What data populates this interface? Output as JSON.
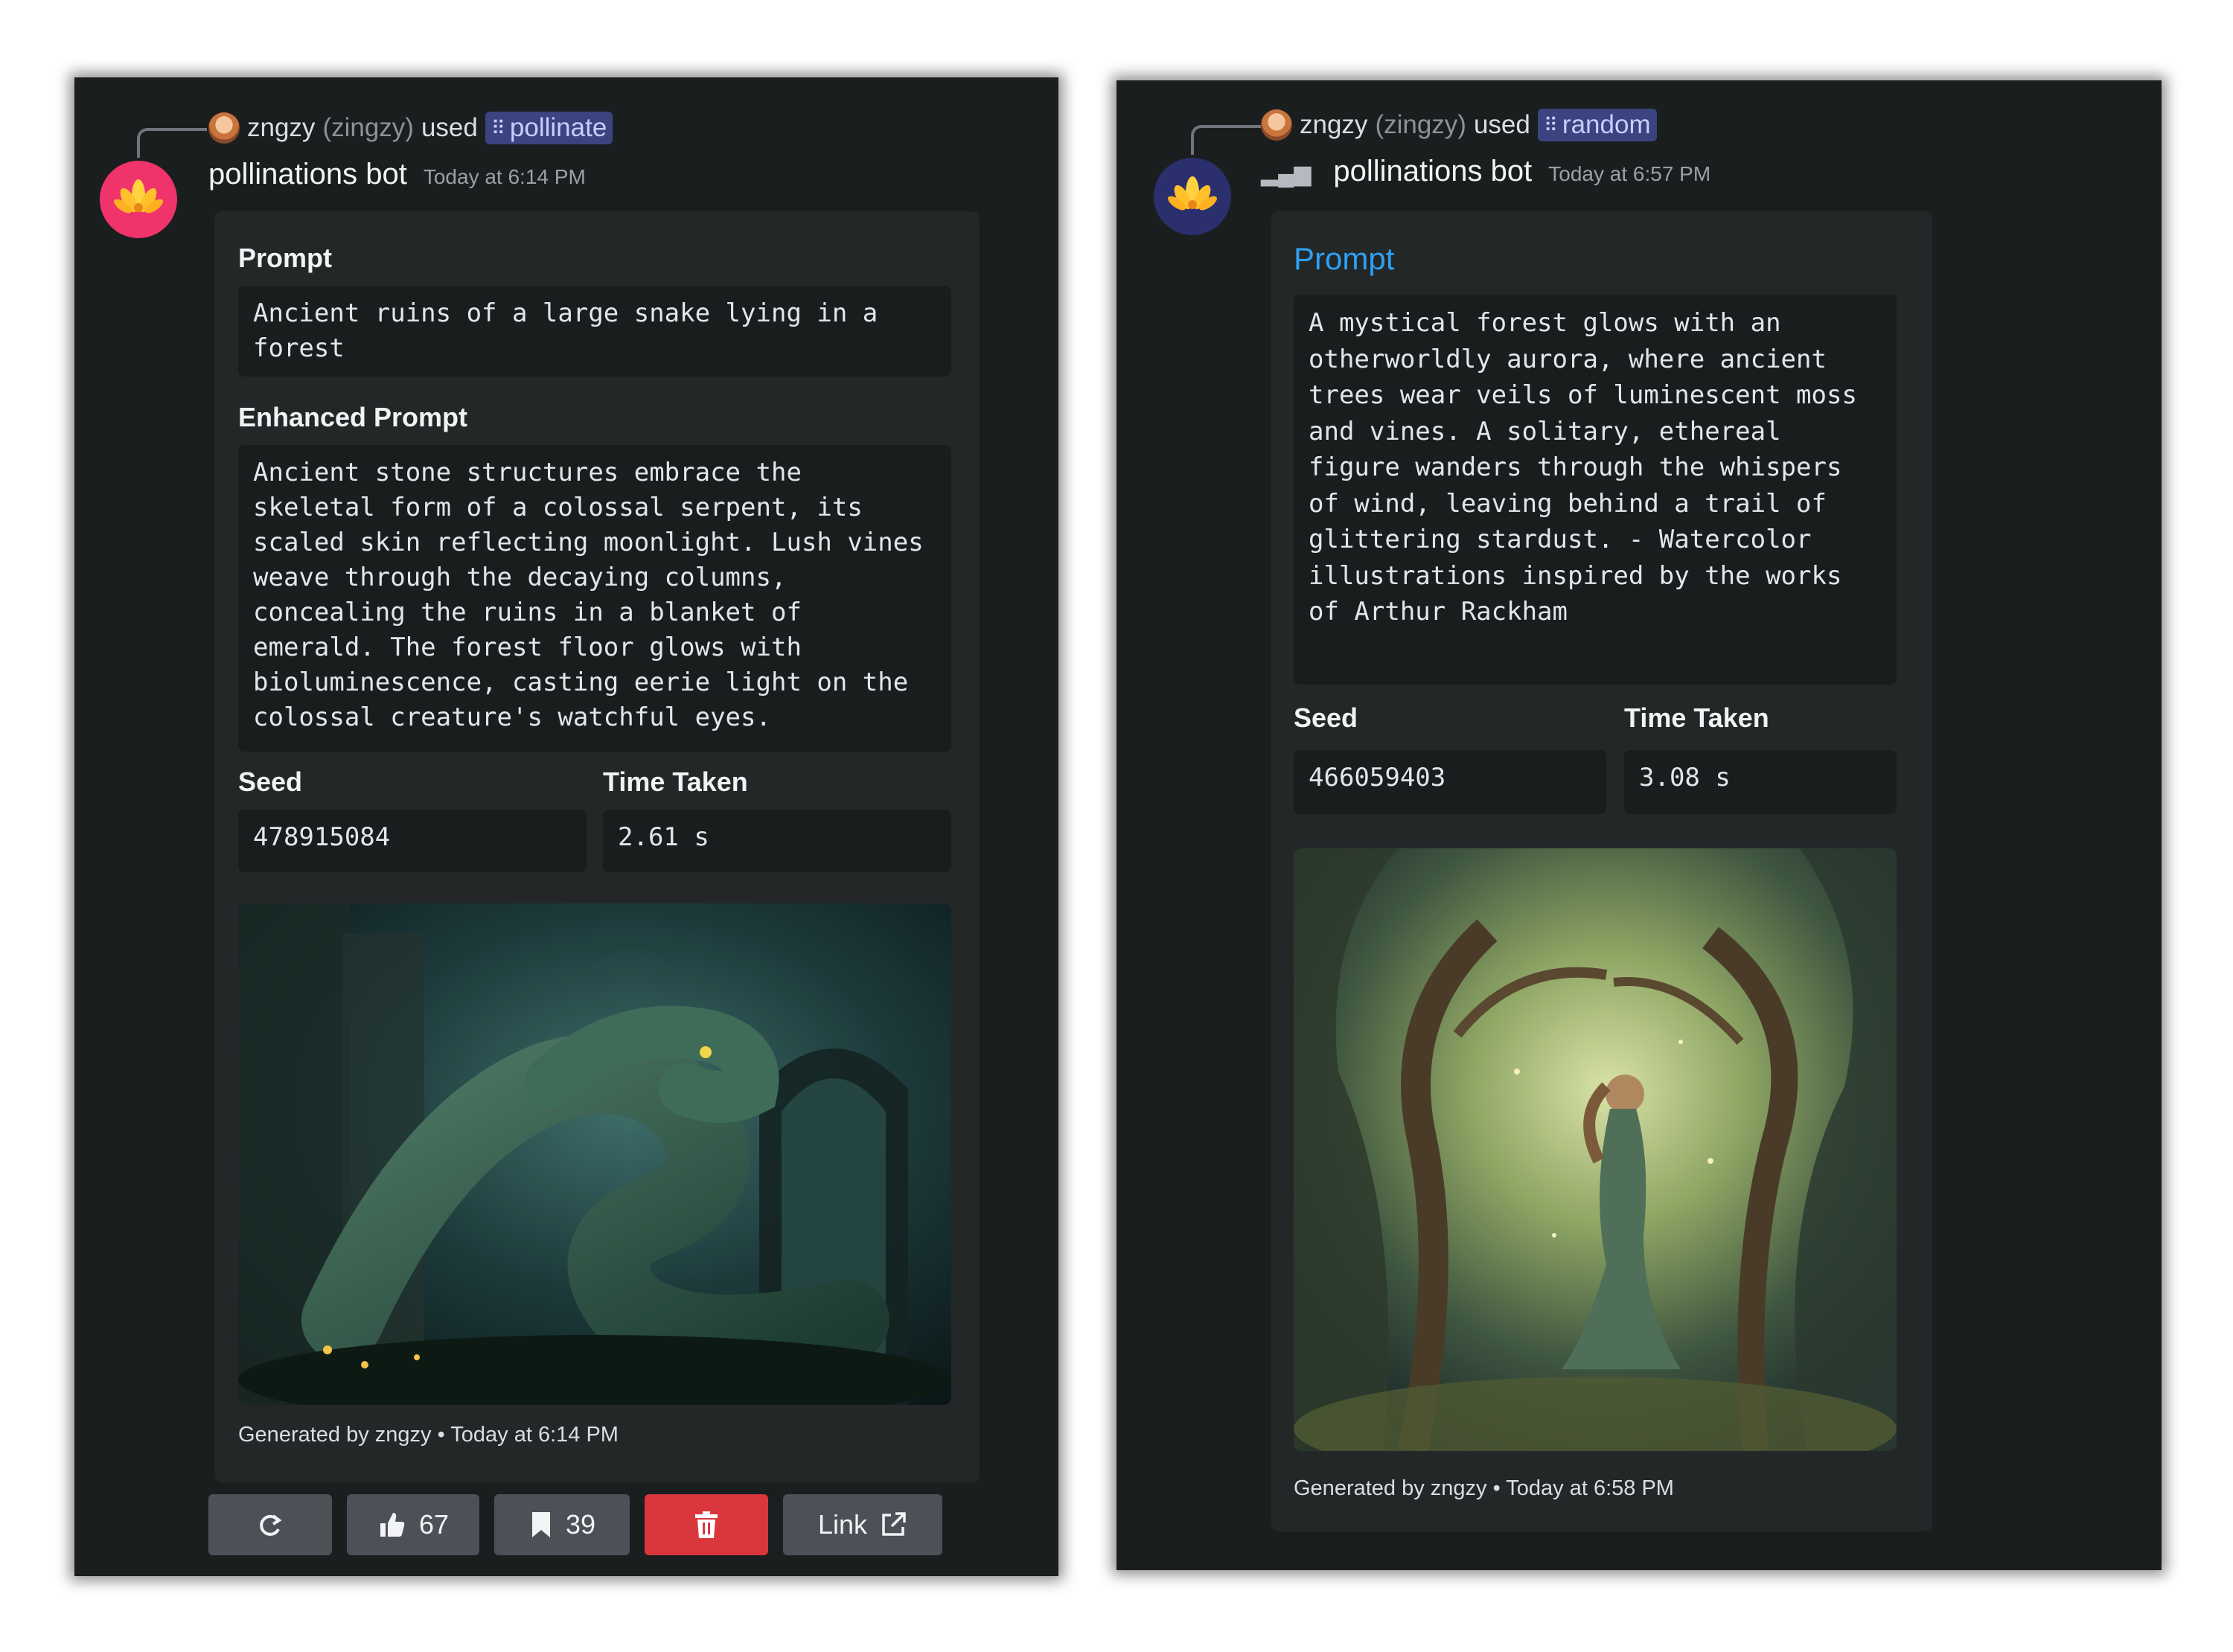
{
  "left": {
    "reply": {
      "user": "zngzy",
      "handle": "(zingzy)",
      "used": "used",
      "command": "pollinate"
    },
    "author": {
      "name": "pollinations bot",
      "timestamp": "Today at 6:14 PM"
    },
    "embed": {
      "prompt_title": "Prompt",
      "prompt": "Ancient ruins of a large snake lying in a forest",
      "enhanced_title": "Enhanced Prompt",
      "enhanced": "Ancient stone structures embrace the skeletal form of a colossal serpent, its scaled skin reflecting moonlight. Lush vines weave through the decaying columns, concealing the ruins in a blanket of emerald. The forest floor glows with bioluminescence, casting eerie light on the colossal creature's watchful eyes.",
      "seed_title": "Seed",
      "seed": "478915084",
      "time_title": "Time Taken",
      "time": "2.61 s",
      "footer": "Generated by zngzy • Today at 6:14 PM"
    },
    "buttons": {
      "like_count": "67",
      "bookmark_count": "39",
      "link_label": "Link"
    }
  },
  "right": {
    "reply": {
      "user": "zngzy",
      "handle": "(zingzy)",
      "used": "used",
      "command": "random"
    },
    "author": {
      "name": "pollinations bot",
      "timestamp": "Today at 6:57 PM"
    },
    "embed": {
      "prompt_title": "Prompt",
      "prompt": "A mystical forest glows with an otherworldly aurora, where ancient trees wear veils of luminescent moss and vines. A solitary, ethereal figure wanders through the whispers of wind, leaving behind a trail of glittering stardust. - Watercolor illustrations inspired by the works of Arthur Rackham",
      "seed_title": "Seed",
      "seed": "466059403",
      "time_title": "Time Taken",
      "time": "3.08 s",
      "footer": "Generated by zngzy • Today at 6:58 PM"
    }
  },
  "colors": {
    "accent_blue": "#2ea0f2",
    "danger": "#da373c",
    "mention_bg": "#3b4380"
  }
}
